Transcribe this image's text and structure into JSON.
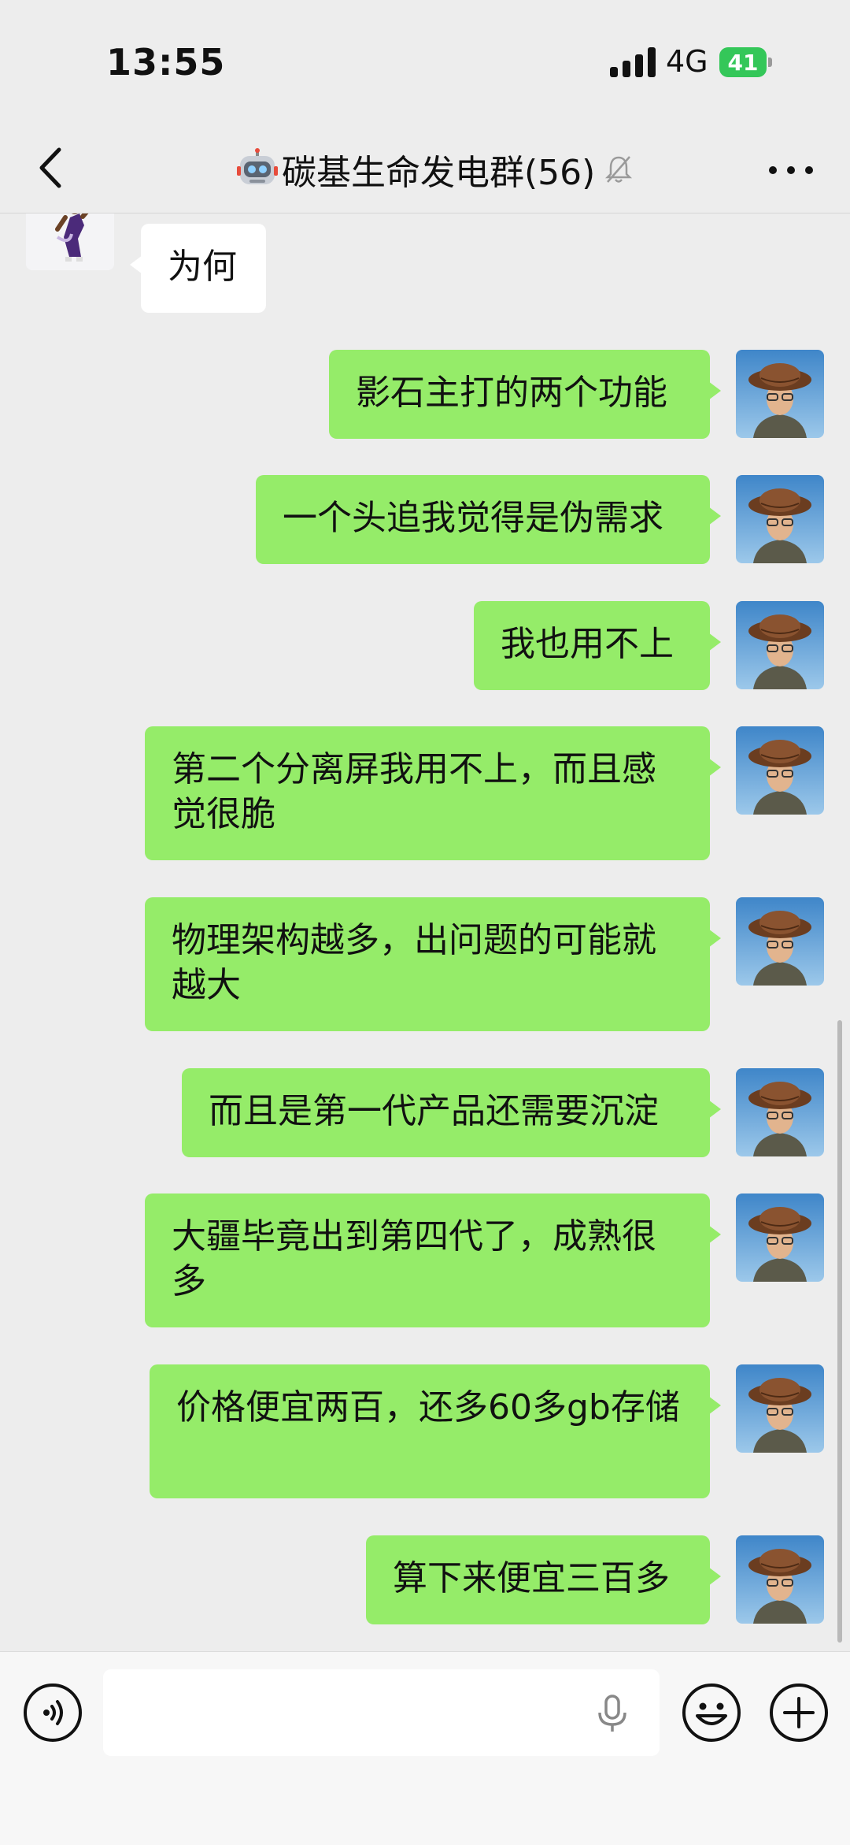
{
  "status_bar": {
    "time": "13:55",
    "network": "4G",
    "battery": "41"
  },
  "header": {
    "title": "碳基生命发电群(56)",
    "icons": [
      "back-arrow-icon",
      "robot-icon",
      "mute-bell-icon",
      "more-icon"
    ]
  },
  "messages": [
    {
      "side": "in",
      "text": "为何"
    },
    {
      "side": "out",
      "text": "影石主打的两个功能"
    },
    {
      "side": "out",
      "text": "一个头追我觉得是伪需求"
    },
    {
      "side": "out",
      "text": "我也用不上"
    },
    {
      "side": "out",
      "text": "第二个分离屏我用不上，而且感觉很脆"
    },
    {
      "side": "out",
      "text": "物理架构越多，出问题的可能就越大"
    },
    {
      "side": "out",
      "text": "而且是第一代产品还需要沉淀"
    },
    {
      "side": "out",
      "text": "大疆毕竟出到第四代了，成熟很多"
    },
    {
      "side": "out",
      "text": "价格便宜两百，还多60多gb存储"
    },
    {
      "side": "out",
      "text": "算下来便宜三百多"
    }
  ],
  "input_bar": {
    "value": "",
    "icons": [
      "voice-icon",
      "mic-icon",
      "emoji-icon",
      "plus-icon"
    ]
  },
  "colors": {
    "background": "#ededed",
    "outgoing_bubble": "#95ec69",
    "incoming_bubble": "#ffffff",
    "battery": "#34c759"
  }
}
